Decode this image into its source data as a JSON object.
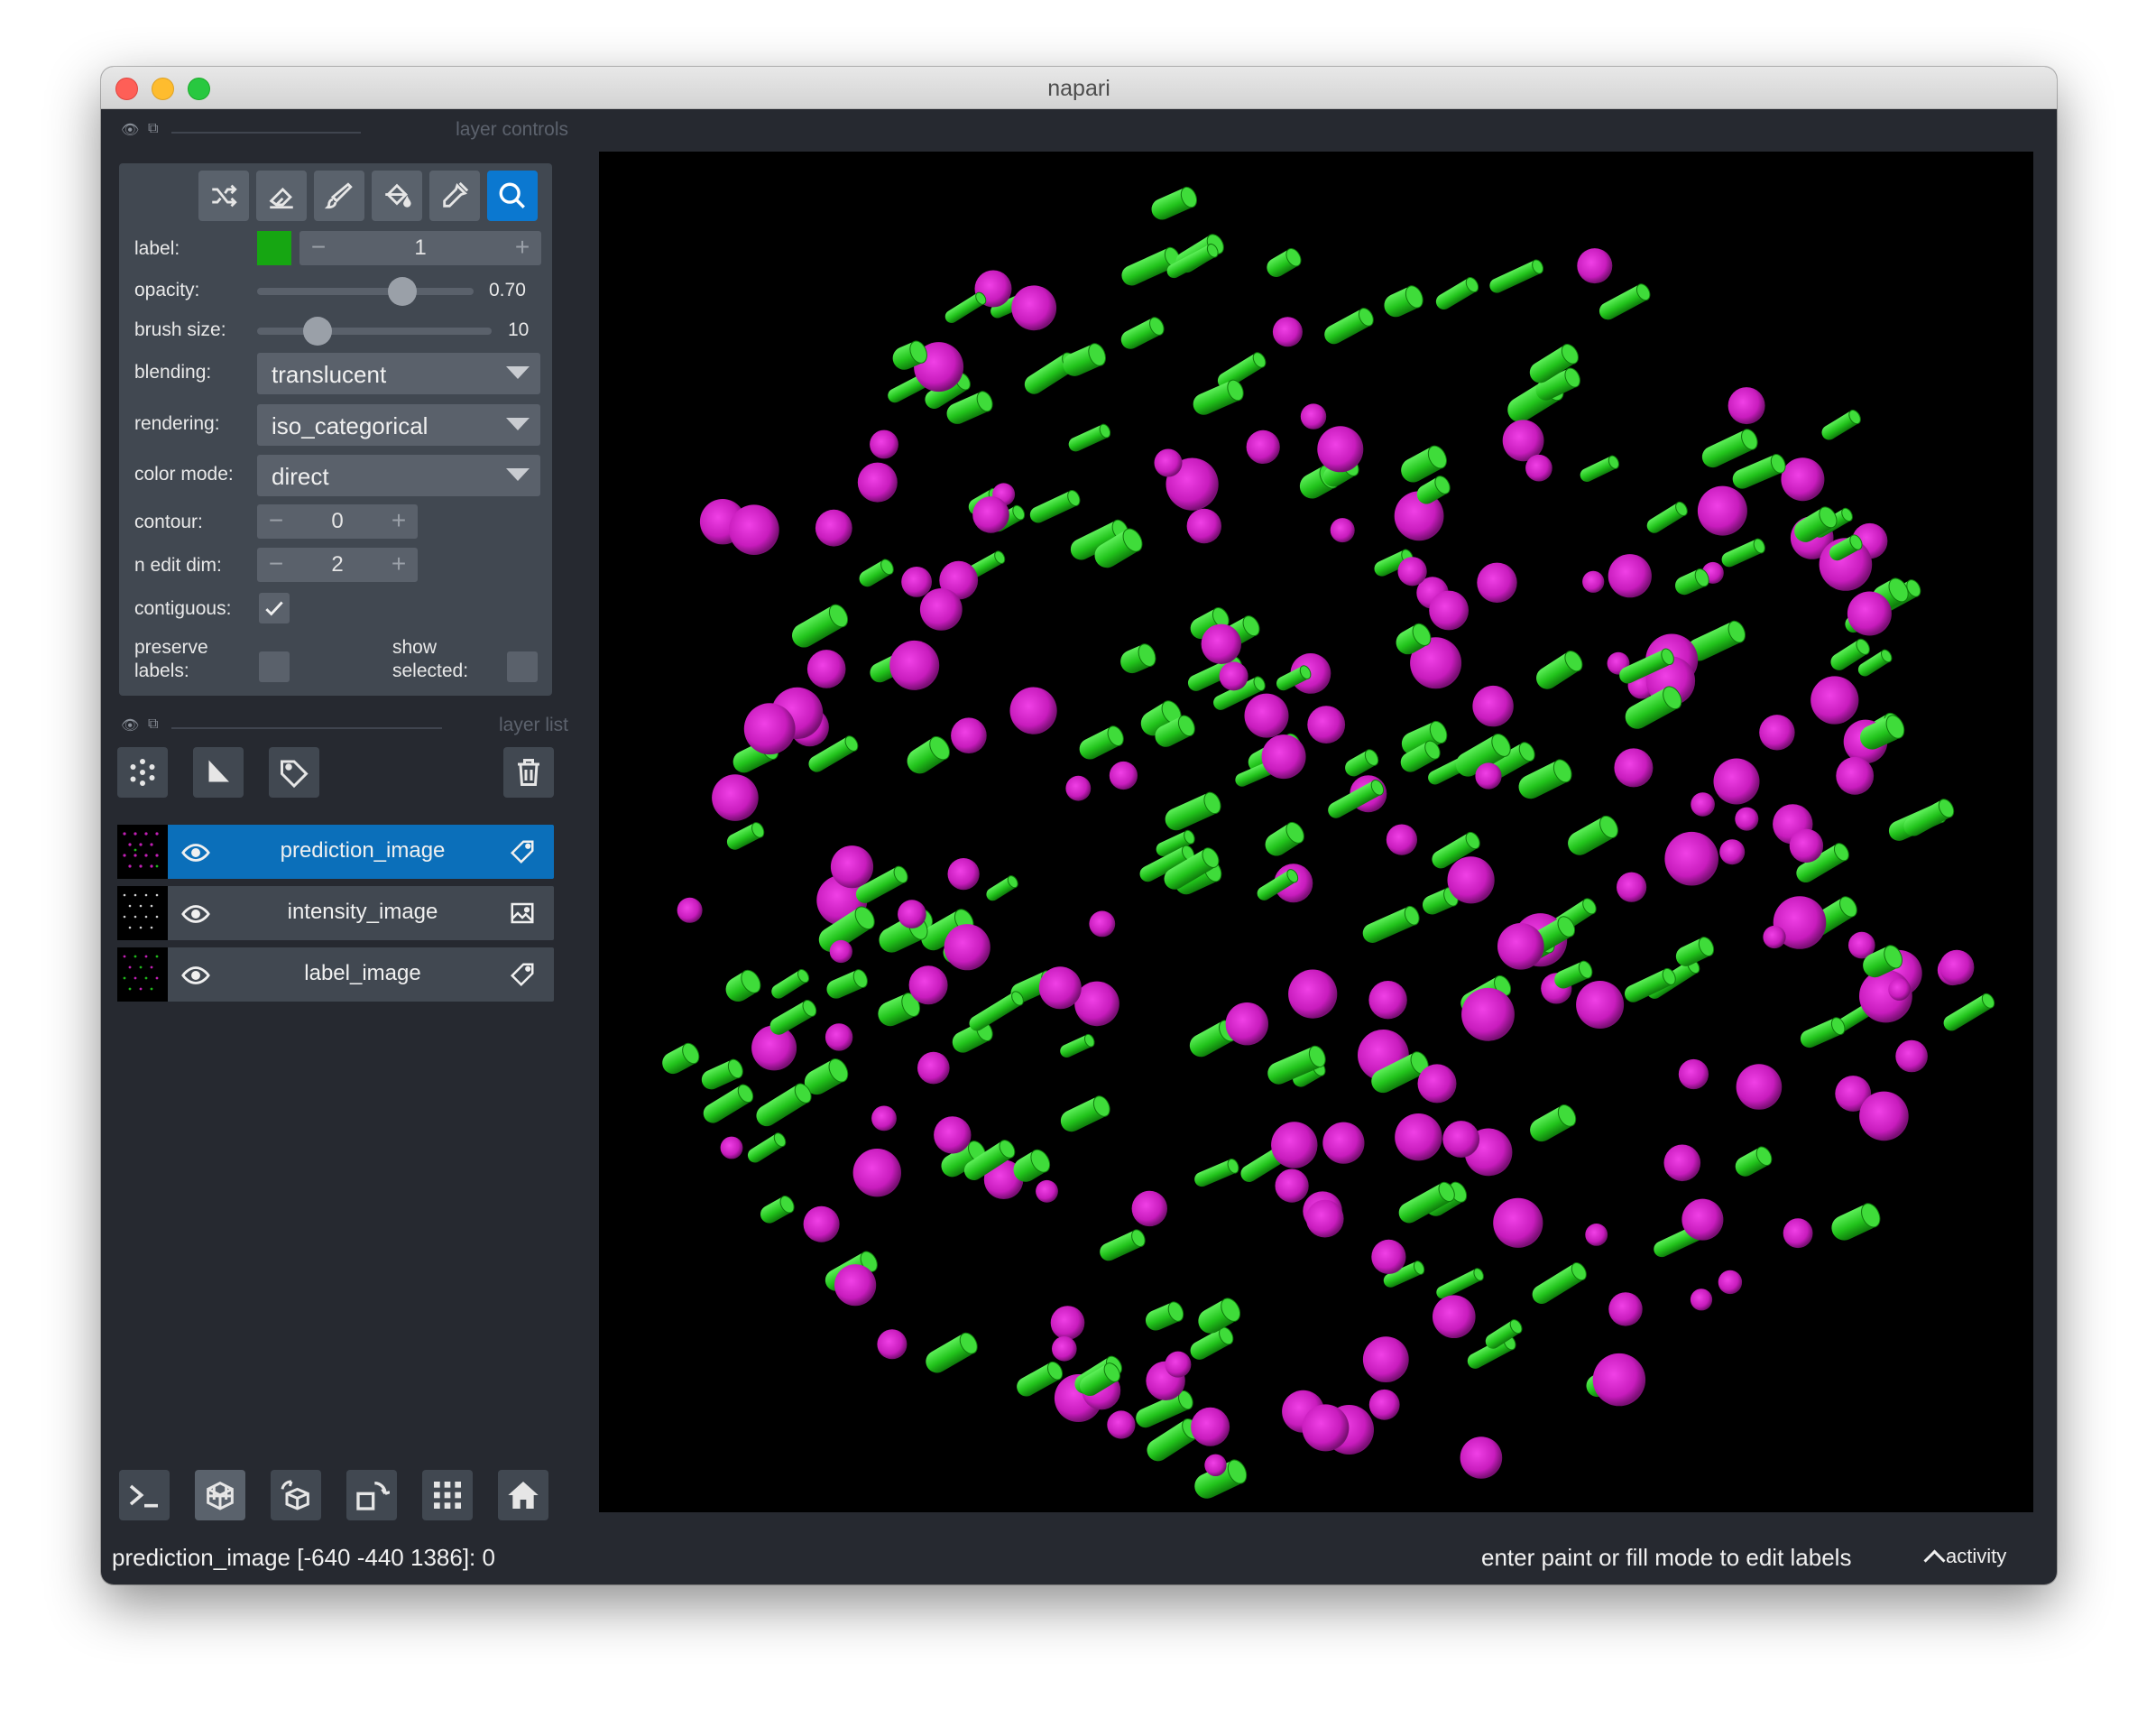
{
  "window": {
    "title": "napari"
  },
  "layer_controls": {
    "header": "layer controls",
    "tools": [
      {
        "name": "shuffle-colors",
        "icon": "shuffle-icon"
      },
      {
        "name": "erase",
        "icon": "eraser-icon"
      },
      {
        "name": "paint",
        "icon": "brush-icon"
      },
      {
        "name": "fill",
        "icon": "paint-bucket-icon"
      },
      {
        "name": "pick",
        "icon": "eyedropper-icon"
      },
      {
        "name": "pan-zoom",
        "icon": "magnifier-icon",
        "active": true
      }
    ],
    "label": {
      "caption": "label:",
      "value": "1",
      "color": "#16a612"
    },
    "opacity": {
      "caption": "opacity:",
      "value": "0.70"
    },
    "brush_size": {
      "caption": "brush size:",
      "value": "10"
    },
    "blending": {
      "caption": "blending:",
      "value": "translucent"
    },
    "rendering": {
      "caption": "rendering:",
      "value": "iso_categorical"
    },
    "color_mode": {
      "caption": "color mode:",
      "value": "direct"
    },
    "contour": {
      "caption": "contour:",
      "value": "0"
    },
    "n_edit_dim": {
      "caption": "n edit dim:",
      "value": "2"
    },
    "contiguous": {
      "caption": "contiguous:",
      "checked": true
    },
    "preserve_labels": {
      "caption_line1": "preserve",
      "caption_line2": "labels:",
      "checked": false
    },
    "show_selected": {
      "caption_line1": "show",
      "caption_line2": "selected:",
      "checked": false
    }
  },
  "layer_list": {
    "header": "layer list",
    "layers": [
      {
        "name": "prediction_image",
        "type": "labels",
        "selected": true,
        "visible": true
      },
      {
        "name": "intensity_image",
        "type": "image",
        "selected": false,
        "visible": true
      },
      {
        "name": "label_image",
        "type": "labels",
        "selected": false,
        "visible": true
      }
    ]
  },
  "bottom_buttons": [
    {
      "name": "console",
      "icon": "terminal-icon"
    },
    {
      "name": "ndisplay",
      "icon": "cube-3d-icon"
    },
    {
      "name": "roll-dims",
      "icon": "rotate-cube-icon"
    },
    {
      "name": "transpose",
      "icon": "transpose-icon"
    },
    {
      "name": "grid-mode",
      "icon": "grid-icon"
    },
    {
      "name": "reset-view",
      "icon": "home-icon"
    }
  ],
  "status": {
    "left": "prediction_image [-640 -440 1386]: 0",
    "right": "enter paint or fill mode to edit labels",
    "activity": "activity"
  },
  "colors": {
    "accent": "#0b78d0",
    "panel": "#414851",
    "background": "#262930",
    "label_green": "#16a612",
    "blob_magenta": "#d81fd0"
  }
}
